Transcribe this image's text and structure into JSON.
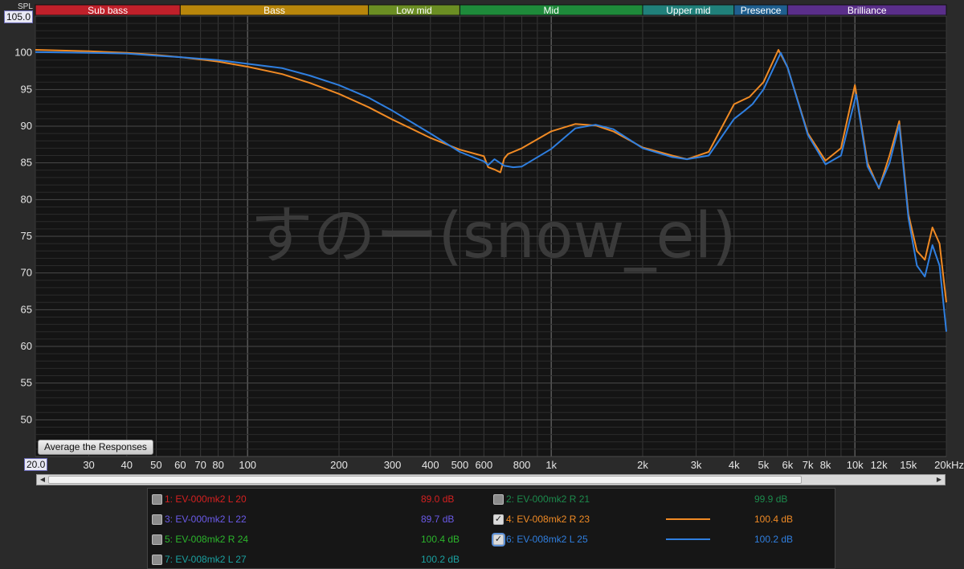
{
  "axis": {
    "y_unit_label": "SPL",
    "y_max_label": "105.0",
    "x_min_label": "20.0",
    "x_unit_suffix": "Hz"
  },
  "bands": [
    {
      "label": "Sub bass",
      "f0": 20,
      "f1": 60,
      "color": "#c0202a"
    },
    {
      "label": "Bass",
      "f0": 60,
      "f1": 250,
      "color": "#b8860b"
    },
    {
      "label": "Low mid",
      "f0": 250,
      "f1": 500,
      "color": "#6b8e23"
    },
    {
      "label": "Mid",
      "f0": 500,
      "f1": 2000,
      "color": "#1e8a3a"
    },
    {
      "label": "Upper mid",
      "f0": 2000,
      "f1": 4000,
      "color": "#20807a"
    },
    {
      "label": "Presence",
      "f0": 4000,
      "f1": 6000,
      "color": "#1f5f8f"
    },
    {
      "label": "Brilliance",
      "f0": 6000,
      "f1": 20000,
      "color": "#5a2e8a"
    }
  ],
  "watermark": "すのー(snow_el)",
  "average_button_label": "Average the Responses",
  "legend": [
    {
      "id": 1,
      "name": "1: EV-000mk2 L 20",
      "value": "89.0 dB",
      "color": "#d42020",
      "checked": false,
      "focused": false
    },
    {
      "id": 2,
      "name": "2: EV-000mk2 R 21",
      "value": "99.9 dB",
      "color": "#1c8a4c",
      "checked": false,
      "focused": false
    },
    {
      "id": 3,
      "name": "3: EV-000mk2 L 22",
      "value": "89.7 dB",
      "color": "#6a5ae8",
      "checked": false,
      "focused": false
    },
    {
      "id": 4,
      "name": "4: EV-008mk2 R 23",
      "value": "100.4 dB",
      "color": "#f08a24",
      "checked": true,
      "focused": false
    },
    {
      "id": 5,
      "name": "5: EV-008mk2 R 24",
      "value": "100.4 dB",
      "color": "#2bb52b",
      "checked": false,
      "focused": false
    },
    {
      "id": 6,
      "name": "6: EV-008mk2 L 25",
      "value": "100.2 dB",
      "color": "#2f7fe0",
      "checked": true,
      "focused": true
    },
    {
      "id": 7,
      "name": "7: EV-008mk2 L 27",
      "value": "100.2 dB",
      "color": "#1aa0a0",
      "checked": false,
      "focused": false
    }
  ],
  "chart_data": {
    "type": "line",
    "xlabel": "Hz",
    "ylabel": "SPL",
    "x_scale": "log",
    "xlim": [
      20,
      20000
    ],
    "ylim": [
      45,
      105
    ],
    "grid": true,
    "ytick_labels": [
      "50",
      "55",
      "60",
      "65",
      "70",
      "75",
      "80",
      "85",
      "90",
      "95",
      "100"
    ],
    "yticks": [
      50,
      55,
      60,
      65,
      70,
      75,
      80,
      85,
      90,
      95,
      100
    ],
    "xticks": [
      30,
      40,
      50,
      60,
      70,
      80,
      100,
      200,
      300,
      400,
      500,
      600,
      800,
      1000,
      2000,
      3000,
      4000,
      5000,
      6000,
      7000,
      8000,
      10000,
      12000,
      15000
    ],
    "xtick_labels": [
      "30",
      "40",
      "50",
      "60",
      "70",
      "80",
      "100",
      "200",
      "300",
      "400",
      "500",
      "600",
      "800",
      "1k",
      "2k",
      "3k",
      "4k",
      "5k",
      "6k",
      "7k",
      "8k",
      "10k",
      "12k",
      "15k",
      "20k"
    ],
    "series": [
      {
        "name": "4: EV-008mk2 R 23",
        "color": "#f08a24",
        "x": [
          20,
          30,
          40,
          50,
          60,
          80,
          100,
          130,
          160,
          200,
          250,
          300,
          400,
          500,
          600,
          620,
          650,
          680,
          700,
          720,
          800,
          1000,
          1200,
          1400,
          1600,
          2000,
          2500,
          2800,
          3300,
          4000,
          4500,
          5000,
          5600,
          6000,
          7000,
          8000,
          9000,
          10000,
          11000,
          12000,
          13000,
          14000,
          15000,
          16000,
          17000,
          18000,
          19000,
          20000
        ],
        "y": [
          100.4,
          100.2,
          100.0,
          99.7,
          99.4,
          98.8,
          98.1,
          97.1,
          95.9,
          94.4,
          92.6,
          90.9,
          88.4,
          86.8,
          85.9,
          84.4,
          84.1,
          83.7,
          85.6,
          86.2,
          87.0,
          89.3,
          90.3,
          90.1,
          89.3,
          87.1,
          86.0,
          85.5,
          86.5,
          93.0,
          94.0,
          96.0,
          100.4,
          98.0,
          89.0,
          85.3,
          87.0,
          95.6,
          85.0,
          81.5,
          86.0,
          90.7,
          78.0,
          73.0,
          71.8,
          76.2,
          74.0,
          66.0
        ]
      },
      {
        "name": "6: EV-008mk2 L 25",
        "color": "#2f7fe0",
        "x": [
          20,
          30,
          40,
          50,
          60,
          80,
          100,
          130,
          160,
          200,
          250,
          300,
          400,
          500,
          600,
          620,
          650,
          700,
          750,
          800,
          1000,
          1200,
          1400,
          1600,
          2000,
          2500,
          2800,
          3300,
          4000,
          4300,
          4600,
          5000,
          5700,
          6000,
          7000,
          8000,
          9000,
          10100,
          11000,
          12000,
          13000,
          14000,
          15000,
          16000,
          17000,
          18000,
          19000,
          20000
        ],
        "y": [
          100.1,
          100.0,
          99.9,
          99.6,
          99.4,
          99.0,
          98.5,
          97.9,
          96.9,
          95.6,
          93.9,
          92.1,
          89.0,
          86.5,
          85.2,
          84.7,
          85.5,
          84.6,
          84.4,
          84.5,
          86.9,
          89.7,
          90.2,
          89.6,
          87.0,
          85.8,
          85.5,
          86.0,
          91.0,
          92.0,
          93.0,
          95.0,
          100.0,
          98.0,
          88.8,
          84.8,
          86.0,
          94.3,
          84.5,
          81.6,
          85.0,
          90.2,
          77.5,
          71.0,
          69.5,
          73.8,
          71.0,
          62.0
        ]
      }
    ]
  }
}
